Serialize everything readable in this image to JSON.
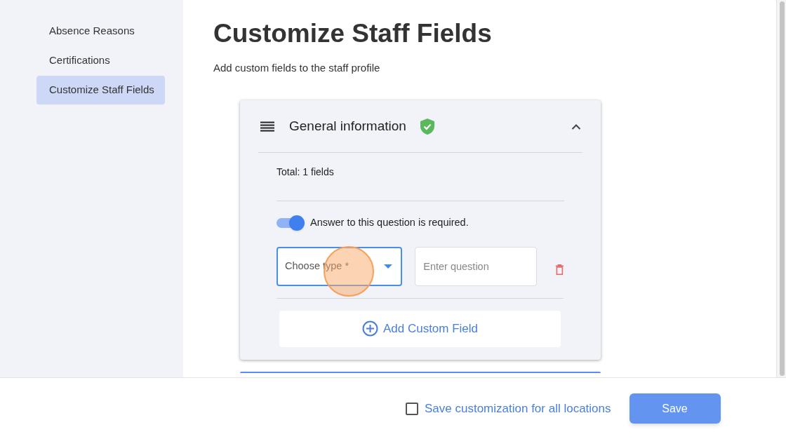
{
  "sidebar": {
    "items": [
      {
        "label": "Absence Reasons",
        "selected": false
      },
      {
        "label": "Certifications",
        "selected": false
      },
      {
        "label": "Customize Staff Fields",
        "selected": true
      }
    ]
  },
  "page": {
    "title": "Customize Staff Fields",
    "subtitle": "Add custom fields to the staff profile"
  },
  "section": {
    "title": "General information",
    "verified": true,
    "expanded": true,
    "total": "Total: 1 fields",
    "fields": [
      {
        "required": {
          "on": true,
          "label": "Answer to this question is required."
        },
        "type_select": {
          "placeholder": "Choose type *",
          "focused": true
        },
        "question": {
          "placeholder": "Enter question"
        }
      }
    ],
    "add_button": "Add Custom Field"
  },
  "footer": {
    "all_locations": {
      "checked": false,
      "label": "Save customization for all locations"
    },
    "save_button": "Save"
  }
}
